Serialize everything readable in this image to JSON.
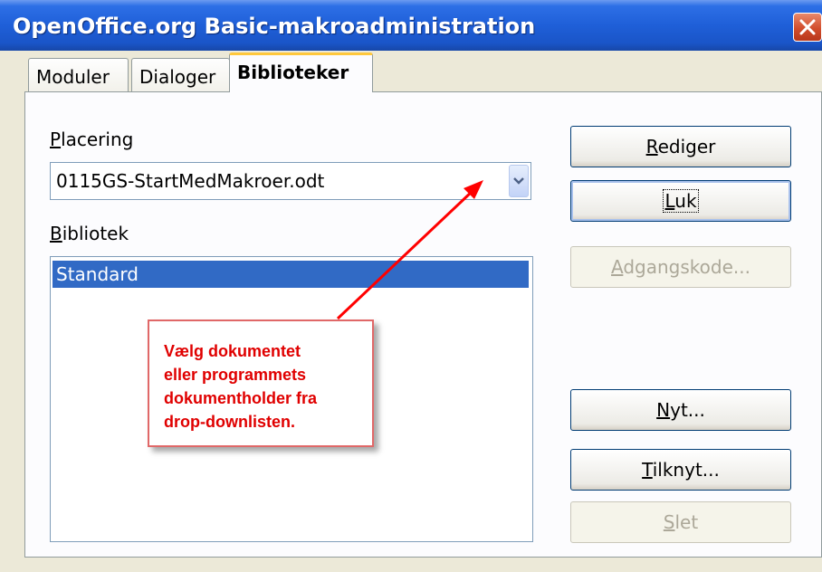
{
  "window": {
    "title": "OpenOffice.org Basic-makroadministration"
  },
  "tabs": [
    {
      "label": "Moduler",
      "active": false
    },
    {
      "label": "Dialoger",
      "active": false
    },
    {
      "label": "Biblioteker",
      "active": true
    }
  ],
  "location": {
    "label_accel": "P",
    "label_rest": "lacering",
    "value": "0115GS-StartMedMakroer.odt"
  },
  "library": {
    "label_accel": "B",
    "label_rest": "ibliotek",
    "items": [
      {
        "label": "Standard",
        "selected": true
      }
    ]
  },
  "buttons": {
    "edit": {
      "accel": "R",
      "rest": "ediger",
      "enabled": true
    },
    "close": {
      "accel": "L",
      "rest": "uk",
      "enabled": true,
      "focused": true
    },
    "password": {
      "accel": "A",
      "rest": "dgangskode...",
      "enabled": false
    },
    "new": {
      "accel": "N",
      "rest": "yt...",
      "enabled": true
    },
    "link": {
      "accel": "T",
      "rest": "ilknyt...",
      "enabled": true
    },
    "delete": {
      "accel": "S",
      "rest": "let",
      "enabled": false
    }
  },
  "callout": {
    "text": "Vælg dokumentet\neller programmets\ndokumentholder fra\ndrop-downlisten."
  },
  "colors": {
    "titlebar": "#1f5fd8",
    "selection": "#316ac5",
    "callout_text": "#e00000",
    "arrow": "#ff0000"
  }
}
